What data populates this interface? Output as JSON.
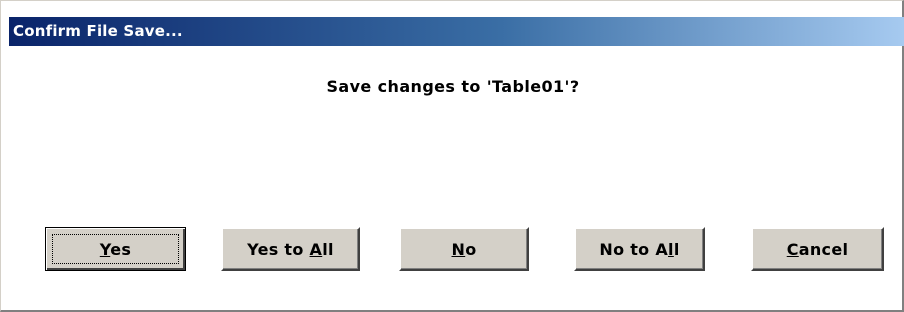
{
  "window": {
    "title": "Confirm File Save..."
  },
  "message": "Save changes to 'Table01'?",
  "buttons": {
    "yes": {
      "pre": "",
      "accel": "Y",
      "post": "es"
    },
    "yes_to_all": {
      "pre": "Yes to ",
      "accel": "A",
      "post": "ll"
    },
    "no": {
      "pre": "",
      "accel": "N",
      "post": "o"
    },
    "no_to_all": {
      "pre": "No to A",
      "accel": "l",
      "post": "l"
    },
    "cancel": {
      "pre": "",
      "accel": "C",
      "post": "ancel"
    }
  },
  "colors": {
    "title_start": "#0a246a",
    "title_end": "#a6caf0",
    "button_face": "#d4d0c8"
  }
}
